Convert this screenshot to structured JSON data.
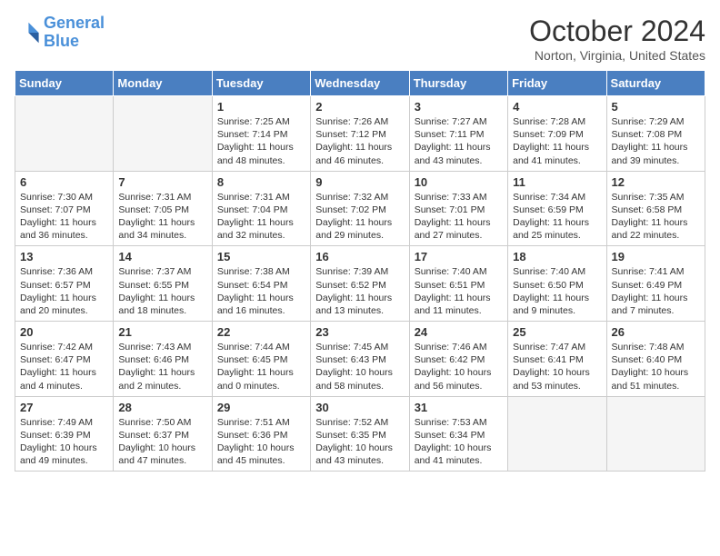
{
  "logo": {
    "line1": "General",
    "line2": "Blue"
  },
  "title": "October 2024",
  "location": "Norton, Virginia, United States",
  "days_header": [
    "Sunday",
    "Monday",
    "Tuesday",
    "Wednesday",
    "Thursday",
    "Friday",
    "Saturday"
  ],
  "weeks": [
    [
      {
        "num": "",
        "empty": true
      },
      {
        "num": "",
        "empty": true
      },
      {
        "num": "1",
        "sunrise": "7:25 AM",
        "sunset": "7:14 PM",
        "daylight": "11 hours and 48 minutes."
      },
      {
        "num": "2",
        "sunrise": "7:26 AM",
        "sunset": "7:12 PM",
        "daylight": "11 hours and 46 minutes."
      },
      {
        "num": "3",
        "sunrise": "7:27 AM",
        "sunset": "7:11 PM",
        "daylight": "11 hours and 43 minutes."
      },
      {
        "num": "4",
        "sunrise": "7:28 AM",
        "sunset": "7:09 PM",
        "daylight": "11 hours and 41 minutes."
      },
      {
        "num": "5",
        "sunrise": "7:29 AM",
        "sunset": "7:08 PM",
        "daylight": "11 hours and 39 minutes."
      }
    ],
    [
      {
        "num": "6",
        "sunrise": "7:30 AM",
        "sunset": "7:07 PM",
        "daylight": "11 hours and 36 minutes."
      },
      {
        "num": "7",
        "sunrise": "7:31 AM",
        "sunset": "7:05 PM",
        "daylight": "11 hours and 34 minutes."
      },
      {
        "num": "8",
        "sunrise": "7:31 AM",
        "sunset": "7:04 PM",
        "daylight": "11 hours and 32 minutes."
      },
      {
        "num": "9",
        "sunrise": "7:32 AM",
        "sunset": "7:02 PM",
        "daylight": "11 hours and 29 minutes."
      },
      {
        "num": "10",
        "sunrise": "7:33 AM",
        "sunset": "7:01 PM",
        "daylight": "11 hours and 27 minutes."
      },
      {
        "num": "11",
        "sunrise": "7:34 AM",
        "sunset": "6:59 PM",
        "daylight": "11 hours and 25 minutes."
      },
      {
        "num": "12",
        "sunrise": "7:35 AM",
        "sunset": "6:58 PM",
        "daylight": "11 hours and 22 minutes."
      }
    ],
    [
      {
        "num": "13",
        "sunrise": "7:36 AM",
        "sunset": "6:57 PM",
        "daylight": "11 hours and 20 minutes."
      },
      {
        "num": "14",
        "sunrise": "7:37 AM",
        "sunset": "6:55 PM",
        "daylight": "11 hours and 18 minutes."
      },
      {
        "num": "15",
        "sunrise": "7:38 AM",
        "sunset": "6:54 PM",
        "daylight": "11 hours and 16 minutes."
      },
      {
        "num": "16",
        "sunrise": "7:39 AM",
        "sunset": "6:52 PM",
        "daylight": "11 hours and 13 minutes."
      },
      {
        "num": "17",
        "sunrise": "7:40 AM",
        "sunset": "6:51 PM",
        "daylight": "11 hours and 11 minutes."
      },
      {
        "num": "18",
        "sunrise": "7:40 AM",
        "sunset": "6:50 PM",
        "daylight": "11 hours and 9 minutes."
      },
      {
        "num": "19",
        "sunrise": "7:41 AM",
        "sunset": "6:49 PM",
        "daylight": "11 hours and 7 minutes."
      }
    ],
    [
      {
        "num": "20",
        "sunrise": "7:42 AM",
        "sunset": "6:47 PM",
        "daylight": "11 hours and 4 minutes."
      },
      {
        "num": "21",
        "sunrise": "7:43 AM",
        "sunset": "6:46 PM",
        "daylight": "11 hours and 2 minutes."
      },
      {
        "num": "22",
        "sunrise": "7:44 AM",
        "sunset": "6:45 PM",
        "daylight": "11 hours and 0 minutes."
      },
      {
        "num": "23",
        "sunrise": "7:45 AM",
        "sunset": "6:43 PM",
        "daylight": "10 hours and 58 minutes."
      },
      {
        "num": "24",
        "sunrise": "7:46 AM",
        "sunset": "6:42 PM",
        "daylight": "10 hours and 56 minutes."
      },
      {
        "num": "25",
        "sunrise": "7:47 AM",
        "sunset": "6:41 PM",
        "daylight": "10 hours and 53 minutes."
      },
      {
        "num": "26",
        "sunrise": "7:48 AM",
        "sunset": "6:40 PM",
        "daylight": "10 hours and 51 minutes."
      }
    ],
    [
      {
        "num": "27",
        "sunrise": "7:49 AM",
        "sunset": "6:39 PM",
        "daylight": "10 hours and 49 minutes."
      },
      {
        "num": "28",
        "sunrise": "7:50 AM",
        "sunset": "6:37 PM",
        "daylight": "10 hours and 47 minutes."
      },
      {
        "num": "29",
        "sunrise": "7:51 AM",
        "sunset": "6:36 PM",
        "daylight": "10 hours and 45 minutes."
      },
      {
        "num": "30",
        "sunrise": "7:52 AM",
        "sunset": "6:35 PM",
        "daylight": "10 hours and 43 minutes."
      },
      {
        "num": "31",
        "sunrise": "7:53 AM",
        "sunset": "6:34 PM",
        "daylight": "10 hours and 41 minutes."
      },
      {
        "num": "",
        "empty": true
      },
      {
        "num": "",
        "empty": true
      }
    ]
  ]
}
